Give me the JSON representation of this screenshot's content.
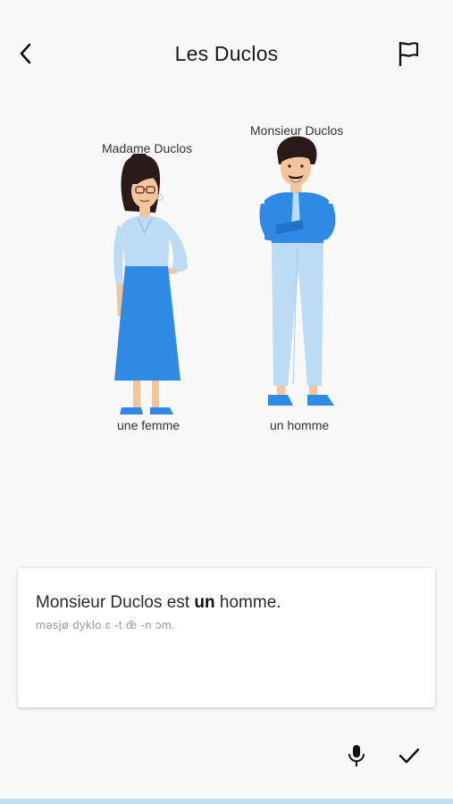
{
  "header": {
    "title": "Les Duclos",
    "back_icon": "chevron-left-icon",
    "flag_icon": "flag-icon"
  },
  "scene": {
    "madame": {
      "name": "Madame Duclos",
      "caption": "une femme"
    },
    "monsieur": {
      "name": "Monsieur Duclos",
      "caption": "un homme"
    }
  },
  "card": {
    "sentence_before": "Monsieur Duclos est ",
    "sentence_bold": "un",
    "sentence_after": " homme.",
    "phonetic": "məsjø dyklo ɛ -t œ̃ -n ɔm."
  },
  "actions": {
    "mic_icon": "microphone-icon",
    "check_icon": "checkmark-icon"
  },
  "colors": {
    "accent_blue": "#2f8ae6",
    "light_blue": "#bcdcf5",
    "bottom_bar": "#bfe0f4"
  }
}
